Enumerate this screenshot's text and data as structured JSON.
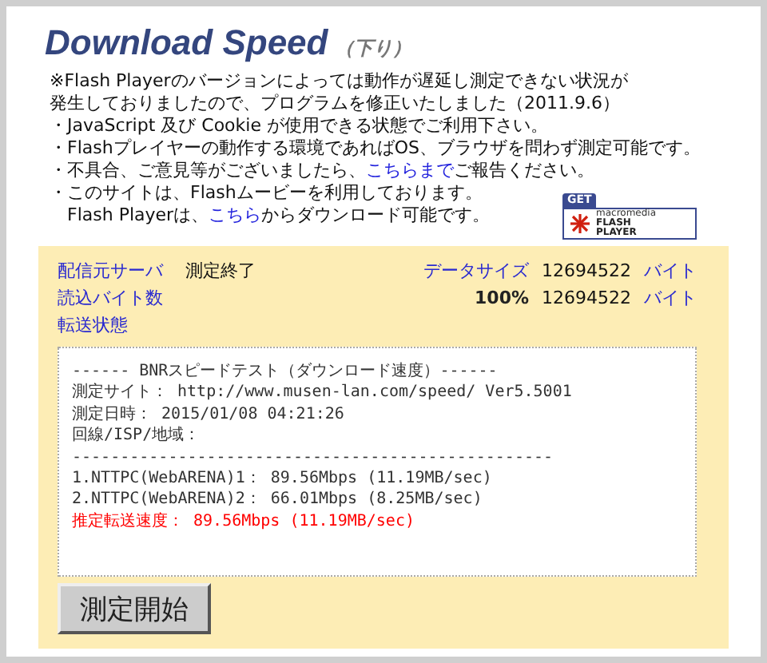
{
  "title": {
    "main": "Download Speed",
    "sub": "（下り）"
  },
  "notes": [
    [
      {
        "kind": "text",
        "text": "※Flash Playerのバージョンによっては動作が遅延し測定できない状況が"
      }
    ],
    [
      {
        "kind": "text",
        "text": "発生しておりましたので、プログラムを修正いたしました（2011.9.6）"
      }
    ],
    [
      {
        "kind": "text",
        "text": "・JavaScript 及び Cookie が使用できる状態でご利用下さい。"
      }
    ],
    [
      {
        "kind": "text",
        "text": "・Flashプレイヤーの動作する環境であればOS、ブラウザを問わず測定可能です。"
      }
    ],
    [
      {
        "kind": "text",
        "text": "・不具合、ご意見等がございましたら、"
      },
      {
        "kind": "link",
        "text": "こちらまで"
      },
      {
        "kind": "text",
        "text": "ご報告ください。"
      }
    ],
    [
      {
        "kind": "text",
        "text": "・このサイトは、Flashムービーを利用しております。"
      }
    ],
    [
      {
        "kind": "text",
        "text": "　Flash Playerは、"
      },
      {
        "kind": "link",
        "text": "こちら"
      },
      {
        "kind": "text",
        "text": "からダウンロード可能です。"
      }
    ]
  ],
  "flash_badge": {
    "get": "GET",
    "brand": "macromedia",
    "product": [
      "FLASH",
      "PLAYER"
    ]
  },
  "status": {
    "server_label": "配信元サーバ",
    "server_value": "測定終了",
    "size_label": "データサイズ",
    "size_value": "12694522",
    "size_unit": "バイト",
    "read_label": "読込バイト数",
    "read_percent": "100%",
    "read_value": "12694522",
    "read_unit": "バイト",
    "transfer_label": "転送状態"
  },
  "result_lines": [
    {
      "kind": "normal",
      "text": "------ BNRスピードテスト（ダウンロード速度）------"
    },
    {
      "kind": "normal",
      "text": "測定サイト： http://www.musen-lan.com/speed/ Ver5.5001"
    },
    {
      "kind": "normal",
      "text": "測定日時： 2015/01/08 04:21:26"
    },
    {
      "kind": "normal",
      "text": "回線/ISP/地域："
    },
    {
      "kind": "normal",
      "text": "--------------------------------------------------"
    },
    {
      "kind": "normal",
      "text": "1.NTTPC(WebARENA)1： 89.56Mbps (11.19MB/sec)"
    },
    {
      "kind": "normal",
      "text": "2.NTTPC(WebARENA)2： 66.01Mbps (8.25MB/sec)"
    },
    {
      "kind": "highlight",
      "text": "推定転送速度： 89.56Mbps (11.19MB/sec)"
    }
  ],
  "start_button": "測定開始"
}
